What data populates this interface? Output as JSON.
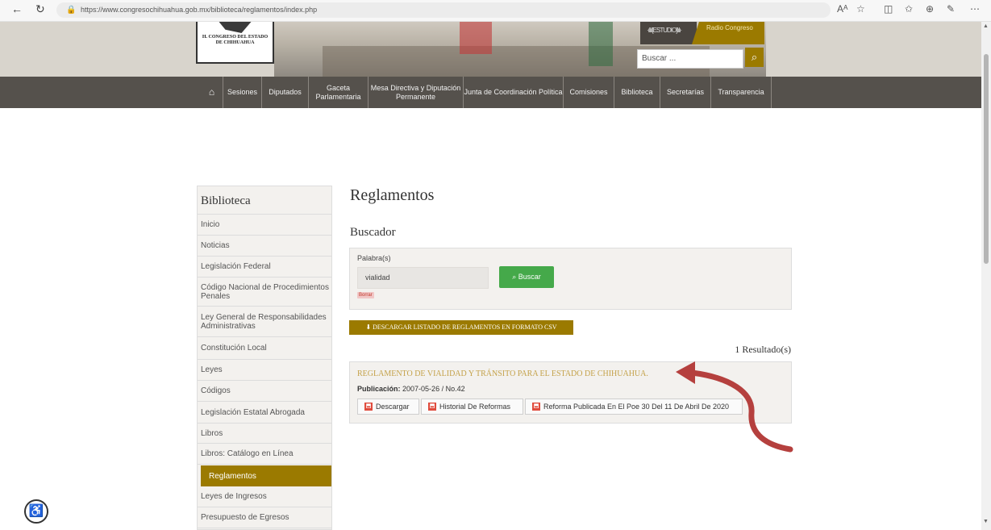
{
  "browser": {
    "url": "https://www.congresochihuahua.gob.mx/biblioteca/reglamentos/index.php",
    "back_icon": "←",
    "refresh_icon": "↻",
    "lock_icon": "🔒",
    "toolbar_icons": [
      "Aᴬ",
      "☆",
      "◫",
      "✩",
      "⊕",
      "✎",
      "⋯"
    ]
  },
  "header": {
    "logo_line1": "H. CONGRESO DEL ESTADO",
    "logo_line2": "DE CHIHUAHUA",
    "radio_label": "Radio Congreso",
    "radio_wave": "·ıllıl[ESTUDIO]lılı·",
    "search_placeholder": "Buscar ...",
    "search_icon": "⌕"
  },
  "nav": {
    "home_icon": "⌂",
    "items": [
      "Sesiones",
      "Diputados",
      "Gaceta Parlamentaria",
      "Mesa Directiva y Diputación Permanente",
      "Junta de Coordinación Política",
      "Comisiones",
      "Biblioteca",
      "Secretarías",
      "Transparencia"
    ]
  },
  "sidebar": {
    "title": "Biblioteca",
    "items": [
      "Inicio",
      "Noticias",
      "Legislación Federal",
      "Código Nacional de Procedimientos Penales",
      "Ley General de Responsabilidades Administrativas",
      "Constitución Local",
      "Leyes",
      "Códigos",
      "Legislación Estatal Abrogada",
      "Libros",
      "Libros: Catálogo en Línea",
      "Reglamentos",
      "Leyes de Ingresos",
      "Presupuesto de Egresos"
    ],
    "active": "Reglamentos"
  },
  "main": {
    "title": "Reglamentos",
    "search_heading": "Buscador",
    "search_label": "Palabra(s)",
    "search_value": "vialidad",
    "search_button": "Buscar",
    "clear_label": "Borrar",
    "csv_button": "DESCARGAR LISTADO DE REGLAMENTOS EN FORMATO CSV",
    "result_count": "1 Resultado(s)",
    "results": [
      {
        "title": "REGLAMENTO DE VIALIDAD Y TRÁNSITO PARA EL ESTADO DE CHIHUAHUA.",
        "pub_label": "Publicación:",
        "pub_value": "2007-05-26 / No.42",
        "buttons": [
          "Descargar",
          "Historial De Reformas",
          "Reforma Publicada En El Poe 30 Del 11 De Abril De 2020"
        ]
      }
    ]
  },
  "annotation": {
    "arrow_color": "#b5403e"
  },
  "accessibility_icon": "♿"
}
